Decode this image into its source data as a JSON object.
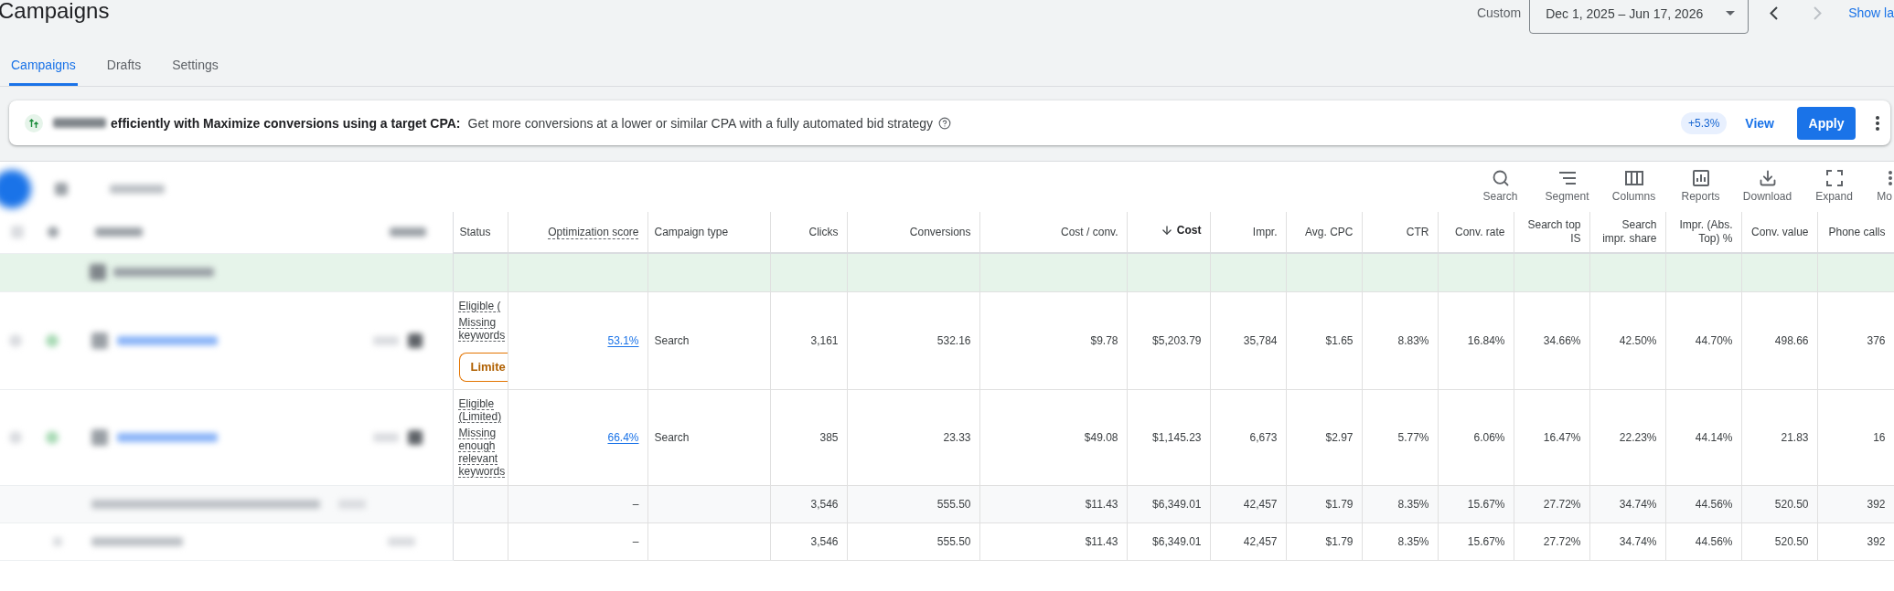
{
  "header": {
    "title": "Campaigns",
    "date_range": {
      "label": "Custom",
      "value": "Dec 1, 2025 – Jun 17, 2026"
    },
    "prev_button": {
      "disabled": false
    },
    "next_button": {
      "disabled": true
    },
    "show_link": "Show la"
  },
  "tabs": [
    {
      "label": "Campaigns",
      "selected": true
    },
    {
      "label": "Drafts",
      "selected": false
    },
    {
      "label": "Settings",
      "selected": false
    }
  ],
  "banner": {
    "headline": "efficiently with Maximize conversions using a target CPA:",
    "body": "Get more conversions at a lower or similar CPA with a fully automated bid strategy",
    "uplift": "+5.3%",
    "view_link": "View",
    "apply_button": "Apply"
  },
  "toolbar": [
    {
      "label": "Search"
    },
    {
      "label": "Segment"
    },
    {
      "label": "Columns"
    },
    {
      "label": "Reports"
    },
    {
      "label": "Download"
    },
    {
      "label": "Expand"
    },
    {
      "label": "Mo"
    }
  ],
  "table": {
    "columns": [
      {
        "label": "Status",
        "kind": "text",
        "has_tooltip": false,
        "sorted": false
      },
      {
        "label": "Optimization score",
        "kind": "number",
        "has_tooltip": true,
        "sorted": false
      },
      {
        "label": "Campaign type",
        "kind": "text",
        "has_tooltip": false,
        "sorted": false
      },
      {
        "label": "Clicks",
        "kind": "number",
        "has_tooltip": false,
        "sorted": false
      },
      {
        "label": "Conversions",
        "kind": "number",
        "has_tooltip": false,
        "sorted": false
      },
      {
        "label": "Cost / conv.",
        "kind": "number",
        "has_tooltip": false,
        "sorted": false
      },
      {
        "label": "Cost",
        "kind": "number",
        "has_tooltip": false,
        "sorted": true
      },
      {
        "label": "Impr.",
        "kind": "number",
        "has_tooltip": false,
        "sorted": false
      },
      {
        "label": "Avg. CPC",
        "kind": "number",
        "has_tooltip": false,
        "sorted": false
      },
      {
        "label": "CTR",
        "kind": "number",
        "has_tooltip": false,
        "sorted": false
      },
      {
        "label": "Conv. rate",
        "kind": "number",
        "has_tooltip": false,
        "sorted": false
      },
      {
        "label": "Search top IS",
        "kind": "number",
        "has_tooltip": false,
        "sorted": false
      },
      {
        "label": "Search impr. share",
        "kind": "number",
        "has_tooltip": false,
        "sorted": false
      },
      {
        "label": "Impr. (Abs. Top) %",
        "kind": "number",
        "has_tooltip": false,
        "sorted": false
      },
      {
        "label": "Conv. value",
        "kind": "number",
        "has_tooltip": false,
        "sorted": false
      },
      {
        "label": "Phone calls",
        "kind": "number",
        "has_tooltip": false,
        "sorted": false
      }
    ],
    "rows": [
      {
        "kind": "group"
      },
      {
        "kind": "campaign",
        "status": {
          "label_lines": [
            "Eligible ("
          ],
          "reason_lines": [
            "Missing",
            "keywords"
          ],
          "badge": "Limite"
        },
        "opt_score": "53.1%",
        "campaign_type": "Search",
        "metrics": [
          "3,161",
          "532.16",
          "$9.78",
          "$5,203.79",
          "35,784",
          "$1.65",
          "8.83%",
          "16.84%",
          "34.66%",
          "42.50%",
          "44.70%",
          "498.66",
          "376"
        ]
      },
      {
        "kind": "campaign",
        "status": {
          "label_lines": [
            "Eligible",
            "(Limited)"
          ],
          "reason_lines": [
            "Missing",
            "enough",
            "relevant",
            "keywords"
          ]
        },
        "opt_score": "66.4%",
        "campaign_type": "Search",
        "metrics": [
          "385",
          "23.33",
          "$49.08",
          "$1,145.23",
          "6,673",
          "$2.97",
          "5.77%",
          "6.06%",
          "16.47%",
          "22.23%",
          "44.14%",
          "21.83",
          "16"
        ]
      },
      {
        "kind": "subtotal",
        "opt_score": "–",
        "metrics": [
          "3,546",
          "555.50",
          "$11.43",
          "$6,349.01",
          "42,457",
          "$1.79",
          "8.35%",
          "15.67%",
          "27.72%",
          "34.74%",
          "44.56%",
          "520.50",
          "392"
        ]
      },
      {
        "kind": "total",
        "opt_score": "–",
        "metrics": [
          "3,546",
          "555.50",
          "$11.43",
          "$6,349.01",
          "42,457",
          "$1.79",
          "8.35%",
          "15.67%",
          "27.72%",
          "34.74%",
          "44.56%",
          "520.50",
          "392"
        ]
      }
    ]
  }
}
